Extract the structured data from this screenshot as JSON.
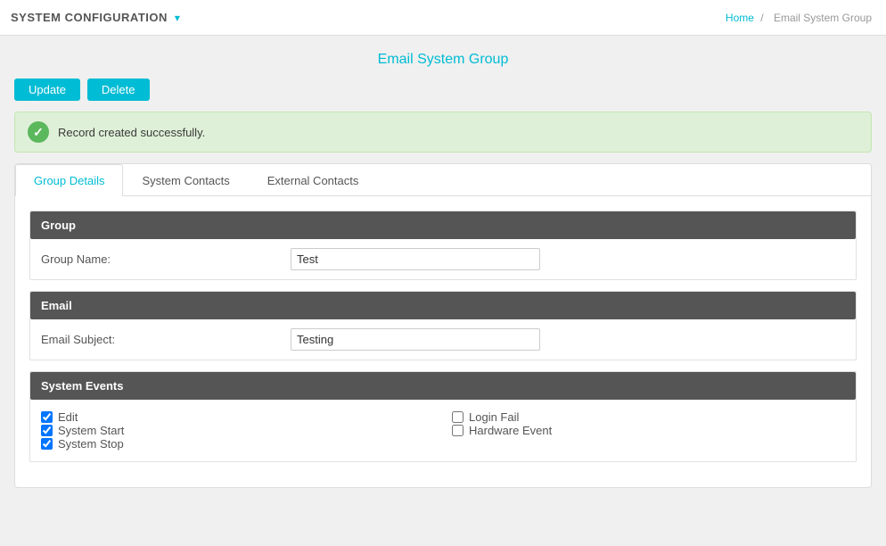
{
  "header": {
    "title": "SYSTEM CONFIGURATION",
    "dropdown_icon": "▾",
    "breadcrumb": {
      "home": "Home",
      "separator": "/",
      "current": "Email System Group"
    }
  },
  "page": {
    "title": "Email System Group"
  },
  "toolbar": {
    "update_label": "Update",
    "delete_label": "Delete"
  },
  "alert": {
    "message": "Record created successfully."
  },
  "tabs": [
    {
      "id": "group-details",
      "label": "Group Details",
      "active": true
    },
    {
      "id": "system-contacts",
      "label": "System Contacts",
      "active": false
    },
    {
      "id": "external-contacts",
      "label": "External Contacts",
      "active": false
    }
  ],
  "sections": {
    "group": {
      "header": "Group",
      "fields": [
        {
          "label": "Group Name:",
          "value": "Test",
          "name": "group_name"
        }
      ]
    },
    "email": {
      "header": "Email",
      "fields": [
        {
          "label": "Email Subject:",
          "value": "Testing",
          "name": "email_subject"
        }
      ]
    },
    "system_events": {
      "header": "System Events",
      "checkboxes_left": [
        {
          "label": "Edit",
          "checked": true
        },
        {
          "label": "System Start",
          "checked": true
        },
        {
          "label": "System Stop",
          "checked": true
        }
      ],
      "checkboxes_right": [
        {
          "label": "Login Fail",
          "checked": false
        },
        {
          "label": "Hardware Event",
          "checked": false
        }
      ]
    }
  }
}
